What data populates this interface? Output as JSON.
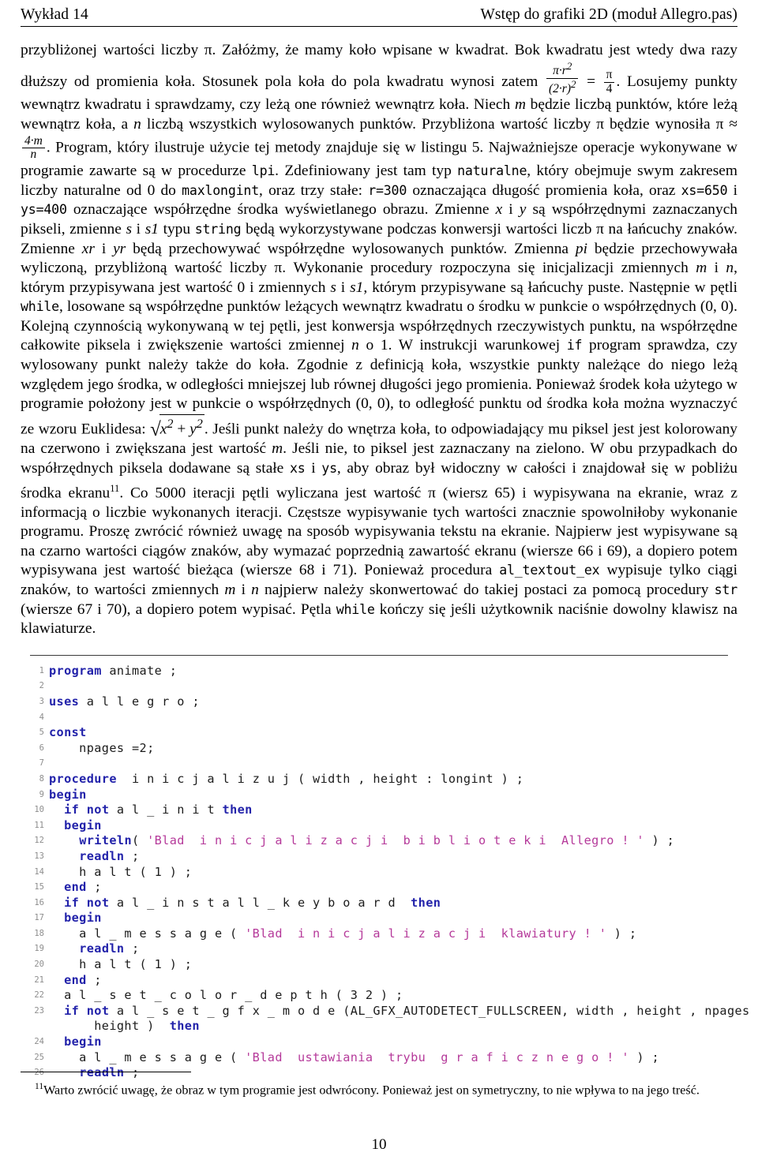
{
  "document": {
    "language": "pl",
    "page_number": "10"
  },
  "header": {
    "left": "Wykład 14",
    "right": "Wstęp do grafiki 2D (moduł Allegro.pas)"
  },
  "prose": {
    "seg_1": "przybliżonej wartości liczby ",
    "pi_1": "π",
    "seg_2": ". Załóżmy, że mamy koło wpisane w kwadrat. Bok kwadratu jest wtedy dwa razy dłuższy od promienia koła. Stosunek pola koła do pola kwadratu wynosi zatem ",
    "frac1_num": "π·r",
    "frac1_num_sup": "2",
    "frac1_den": "(2·r)",
    "frac1_den_sup": "2",
    "eq": " = ",
    "frac2_num": "π",
    "frac2_den": "4",
    "seg_3": ". Losujemy punkty wewnątrz kwadratu i sprawdzamy, czy leżą one również wewnątrz koła. Niech ",
    "var_m_1": "m",
    "seg_4": " będzie liczbą punktów, które leżą wewnątrz koła, a ",
    "var_n_1": "n",
    "seg_5": " liczbą wszystkich wylosowanych punktów. Przybliżona wartość liczby ",
    "pi_2": "π",
    "seg_6": " będzie wynosiła ",
    "pi_3": "π",
    "approx": " ≈ ",
    "frac3_num": "4·m",
    "frac3_den": "n",
    "seg_7": ". Program, który ilustruje użycie tej metody znajduje się w listingu 5. Najważniejsze operacje wykonywane w programie zawarte są w procedurze ",
    "code_lpi": "lpi",
    "seg_8": ". Zdefiniowany jest tam typ ",
    "code_naturalne": "naturalne",
    "seg_9": ", który obejmuje swym zakresem liczby naturalne od 0 do ",
    "code_maxlongint": "maxlongint",
    "seg_10": ", oraz trzy stałe: ",
    "code_r300": "r=300",
    "seg_11": " oznaczająca długość promienia koła, oraz ",
    "code_xs650": "xs=650",
    "seg_12": " i ",
    "code_ys400": "ys=400",
    "seg_13": " oznaczające współrzędne środka wyświetlanego obrazu. Zmienne ",
    "var_x_1": "x",
    "seg_14": " i ",
    "var_y_1": "y",
    "seg_15": " są współrzędnymi zaznaczanych pikseli, zmienne ",
    "var_s_1": "s",
    "seg_16": " i ",
    "var_s1_1": "s1",
    "seg_17": " typu ",
    "code_string": "string",
    "seg_18": " będą wykorzystywane podczas konwersji wartości liczb ",
    "pi_4": "π",
    "seg_19": " na łańcuchy znaków. Zmienne ",
    "var_xr": "xr",
    "seg_20": " i ",
    "var_yr": "yr",
    "seg_21": " będą przechowywać współrzędne wylosowanych punktów. Zmienna ",
    "var_pi": "pi",
    "seg_22": " będzie przechowywała wyliczoną, przybliżoną wartość liczby ",
    "pi_5": "π",
    "seg_23": ". Wykonanie procedury rozpoczyna się inicjalizacji zmiennych ",
    "var_m_2": "m",
    "seg_24": " i ",
    "var_n_2": "n",
    "seg_25": ", którym przypisywana jest wartość 0 i zmiennych ",
    "var_s_2": "s",
    "seg_26": " i ",
    "var_s1_2": "s1",
    "seg_27": ", którym przypisywane są łańcuchy puste. Następnie w pętli ",
    "code_while_1": "while",
    "seg_28": ", losowane są współrzędne punktów leżących wewnątrz kwadratu o środku w punkcie o współrzędnych (0, 0). Kolejną czynnością wykonywaną w tej pętli, jest konwersja współrzędnych rzeczywistych punktu, na współrzędne całkowite piksela i zwiększenie wartości zmiennej ",
    "var_n_3": "n",
    "seg_29": " o 1. W instrukcji warunkowej ",
    "code_if": "if",
    "seg_30": " program sprawdza, czy wylosowany punkt należy także do koła. Zgodnie z definicją koła, wszystkie punkty należące do niego leżą względem jego środka, w odległości mniejszej lub równej długości jego promienia. Ponieważ środek koła użytego w programie położony jest w punkcie o współrzędnych (0, 0), to odległość punktu od środka koła można wyznaczyć ze wzoru Euklidesa: ",
    "sqrt_radicand": "x",
    "sqrt_sup1": "2",
    "sqrt_plus": " + ",
    "sqrt_radicand2": "y",
    "sqrt_sup2": "2",
    "seg_31": ". Jeśli punkt należy do wnętrza koła, to odpowiadający mu piksel jest jest kolorowany na czerwono i zwiększana jest wartość ",
    "var_m_3": "m",
    "seg_32": ". Jeśli nie, to piksel jest zaznaczany na zielono. W obu przypadkach do współrzędnych piksela dodawane są stałe ",
    "code_xs": "xs",
    "seg_33": " i ",
    "code_ys": "ys",
    "seg_34": ", aby obraz był widoczny w całości i znajdował się w pobliżu środka ekranu",
    "fn_marker": "11",
    "seg_35": ". Co 5000 iteracji pętli wyliczana jest wartość ",
    "pi_6": "π",
    "seg_36": " (wiersz 65) i wypisywana na ekranie, wraz z informacją o liczbie wykonanych iteracji. Częstsze wypisywanie tych wartości znacznie spowolniłoby wykonanie programu. Proszę zwrócić również uwagę na sposób wypisywania tekstu na ekranie. Najpierw jest wypisywane są na czarno wartości ciągów znaków, aby wymazać poprzednią zawartość ekranu (wiersze 66 i 69), a dopiero potem wypisywana jest wartość bieżąca (wiersze 68 i 71). Ponieważ procedura ",
    "code_altextout": "al_textout_ex",
    "seg_37": " wypisuje tylko ciągi znaków, to wartości zmiennych ",
    "var_m_4": "m",
    "seg_38": " i ",
    "var_n_4": "n",
    "seg_39": " najpierw należy skonwertować do takiej postaci za pomocą procedury ",
    "code_str": "str",
    "seg_40": " (wiersze 67 i 70), a dopiero potem wypisać. Pętla ",
    "code_while_2": "while",
    "seg_41": " kończy się jeśli użytkownik naciśnie dowolny klawisz na klawiaturze."
  },
  "listing": {
    "lines": [
      {
        "n": "1",
        "tokens": [
          {
            "t": "kw",
            "v": "program"
          },
          {
            "t": "pl",
            "v": " animate ;"
          }
        ]
      },
      {
        "n": "2",
        "tokens": [
          {
            "t": "pl",
            "v": ""
          }
        ]
      },
      {
        "n": "3",
        "tokens": [
          {
            "t": "kw",
            "v": "uses"
          },
          {
            "t": "pl",
            "v": " a l l e g r o ;"
          }
        ]
      },
      {
        "n": "4",
        "tokens": [
          {
            "t": "pl",
            "v": ""
          }
        ]
      },
      {
        "n": "5",
        "tokens": [
          {
            "t": "kw",
            "v": "const"
          }
        ]
      },
      {
        "n": "6",
        "tokens": [
          {
            "t": "pl",
            "v": "    npages =2;"
          }
        ]
      },
      {
        "n": "7",
        "tokens": [
          {
            "t": "pl",
            "v": ""
          }
        ]
      },
      {
        "n": "8",
        "tokens": [
          {
            "t": "kw",
            "v": "procedure"
          },
          {
            "t": "pl",
            "v": "  i n i c j a l i z u j ( width , height : longint ) ;"
          }
        ]
      },
      {
        "n": "9",
        "tokens": [
          {
            "t": "kw",
            "v": "begin"
          }
        ]
      },
      {
        "n": "10",
        "tokens": [
          {
            "t": "pl",
            "v": "  "
          },
          {
            "t": "kw",
            "v": "if"
          },
          {
            "t": "pl",
            "v": " "
          },
          {
            "t": "kw",
            "v": "not"
          },
          {
            "t": "pl",
            "v": " a l _ i n i t "
          },
          {
            "t": "kw",
            "v": "then"
          }
        ]
      },
      {
        "n": "11",
        "tokens": [
          {
            "t": "pl",
            "v": "  "
          },
          {
            "t": "kw",
            "v": "begin"
          }
        ]
      },
      {
        "n": "12",
        "tokens": [
          {
            "t": "pl",
            "v": "    "
          },
          {
            "t": "kw",
            "v": "writeln"
          },
          {
            "t": "pl",
            "v": "( "
          },
          {
            "t": "str",
            "v": "'Blad  i n i c j a l i z a c j i  b i b l i o t e k i  Allegro ! '"
          },
          {
            "t": "pl",
            "v": " ) ;"
          }
        ]
      },
      {
        "n": "13",
        "tokens": [
          {
            "t": "pl",
            "v": "    "
          },
          {
            "t": "kw",
            "v": "readln"
          },
          {
            "t": "pl",
            "v": " ;"
          }
        ]
      },
      {
        "n": "14",
        "tokens": [
          {
            "t": "pl",
            "v": "    h a l t ( 1 ) ;"
          }
        ]
      },
      {
        "n": "15",
        "tokens": [
          {
            "t": "pl",
            "v": "  "
          },
          {
            "t": "kw",
            "v": "end"
          },
          {
            "t": "pl",
            "v": " ;"
          }
        ]
      },
      {
        "n": "16",
        "tokens": [
          {
            "t": "pl",
            "v": "  "
          },
          {
            "t": "kw",
            "v": "if"
          },
          {
            "t": "pl",
            "v": " "
          },
          {
            "t": "kw",
            "v": "not"
          },
          {
            "t": "pl",
            "v": " a l _ i n s t a l l _ k e y b o a r d  "
          },
          {
            "t": "kw",
            "v": "then"
          }
        ]
      },
      {
        "n": "17",
        "tokens": [
          {
            "t": "pl",
            "v": "  "
          },
          {
            "t": "kw",
            "v": "begin"
          }
        ]
      },
      {
        "n": "18",
        "tokens": [
          {
            "t": "pl",
            "v": "    a l _ m e s s a g e ( "
          },
          {
            "t": "str",
            "v": "'Blad  i n i c j a l i z a c j i  klawiatury ! '"
          },
          {
            "t": "pl",
            "v": " ) ;"
          }
        ]
      },
      {
        "n": "19",
        "tokens": [
          {
            "t": "pl",
            "v": "    "
          },
          {
            "t": "kw",
            "v": "readln"
          },
          {
            "t": "pl",
            "v": " ;"
          }
        ]
      },
      {
        "n": "20",
        "tokens": [
          {
            "t": "pl",
            "v": "    h a l t ( 1 ) ;"
          }
        ]
      },
      {
        "n": "21",
        "tokens": [
          {
            "t": "pl",
            "v": "  "
          },
          {
            "t": "kw",
            "v": "end"
          },
          {
            "t": "pl",
            "v": " ;"
          }
        ]
      },
      {
        "n": "22",
        "tokens": [
          {
            "t": "pl",
            "v": "  a l _ s e t _ c o l o r _ d e p t h ( 3 2 ) ;"
          }
        ]
      },
      {
        "n": "23",
        "tokens": [
          {
            "t": "pl",
            "v": "  "
          },
          {
            "t": "kw",
            "v": "if"
          },
          {
            "t": "pl",
            "v": " "
          },
          {
            "t": "kw",
            "v": "not"
          },
          {
            "t": "pl",
            "v": " a l _ s e t _ g f x _ m o d e (AL_GFX_AUTODETECT_FULLSCREEN, width , height , npages ∗ width , npages ∗"
          }
        ]
      },
      {
        "n": "",
        "tokens": [
          {
            "t": "pl",
            "v": "      height )  "
          },
          {
            "t": "kw",
            "v": "then"
          }
        ]
      },
      {
        "n": "24",
        "tokens": [
          {
            "t": "pl",
            "v": "  "
          },
          {
            "t": "kw",
            "v": "begin"
          }
        ]
      },
      {
        "n": "25",
        "tokens": [
          {
            "t": "pl",
            "v": "    a l _ m e s s a g e ( "
          },
          {
            "t": "str",
            "v": "'Blad  ustawiania  trybu  g r a f i c z n e g o ! '"
          },
          {
            "t": "pl",
            "v": " ) ;"
          }
        ]
      },
      {
        "n": "26",
        "tokens": [
          {
            "t": "pl",
            "v": "    "
          },
          {
            "t": "kw",
            "v": "readln"
          },
          {
            "t": "pl",
            "v": " ;"
          }
        ]
      }
    ]
  },
  "footnote": {
    "marker": "11",
    "text": "Warto zwrócić uwagę, że obraz w tym programie jest odwrócony. Ponieważ jest on symetryczny, to nie wpływa to na jego treść."
  },
  "colors": {
    "keyword": "#2222aa",
    "string": "#b5399a",
    "plain": "#1b1b1b",
    "line_number": "#8e8e8e",
    "rule": "#000000"
  }
}
